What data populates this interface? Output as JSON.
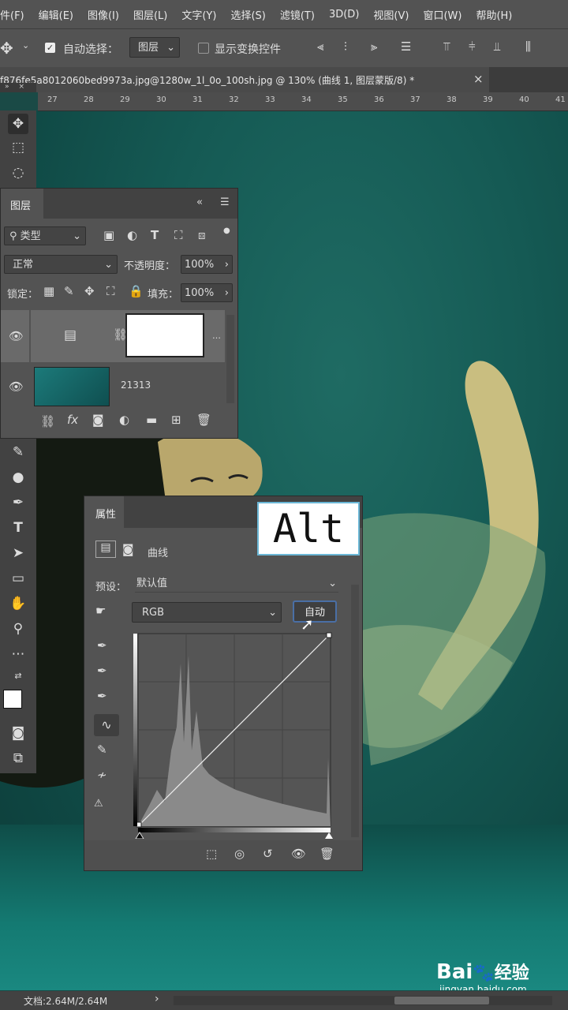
{
  "menubar": {
    "items": [
      "件(F)",
      "编辑(E)",
      "图像(I)",
      "图层(L)",
      "文字(Y)",
      "选择(S)",
      "滤镜(T)",
      "3D(D)",
      "视图(V)",
      "窗口(W)",
      "帮助(H)"
    ]
  },
  "options": {
    "auto_select_label": "自动选择：",
    "auto_select_value": "图层",
    "show_transform_label": "显示变换控件"
  },
  "document_tab": {
    "title": "f876fe5a8012060bed9973a.jpg@1280w_1l_0o_100sh.jpg @ 130% (曲线 1, 图层蒙版/8) *",
    "close": "×"
  },
  "ruler": {
    "ticks": [
      "27",
      "28",
      "29",
      "30",
      "31",
      "32",
      "33",
      "34",
      "35",
      "36",
      "37",
      "38",
      "39",
      "40",
      "41"
    ]
  },
  "layers_panel": {
    "title": "图层",
    "filter_label": "类型",
    "blend_mode": "正常",
    "opacity_label": "不透明度：",
    "opacity_value": "100%",
    "lock_label": "锁定：",
    "fill_label": "填充：",
    "fill_value": "100%",
    "layers": [
      {
        "name": "",
        "type": "curves-adjustment",
        "selected": true
      },
      {
        "name": "21313",
        "type": "image",
        "selected": false
      }
    ]
  },
  "properties_panel": {
    "title": "属性",
    "adjustment_name": "曲线",
    "preset_label": "预设：",
    "preset_value": "默认值",
    "channel_value": "RGB",
    "auto_button": "自动"
  },
  "overlay_key": "Alt",
  "status": {
    "doc_info": "文档:2.64M/2.64M",
    "arrow": "›"
  },
  "watermark": {
    "brand": "Bai",
    "brand2": "经验",
    "url": "jingyan.baidu.com"
  },
  "colors": {
    "panel_bg": "#535353",
    "panel_dark": "#424242",
    "accent_border": "#6bb7d6"
  }
}
